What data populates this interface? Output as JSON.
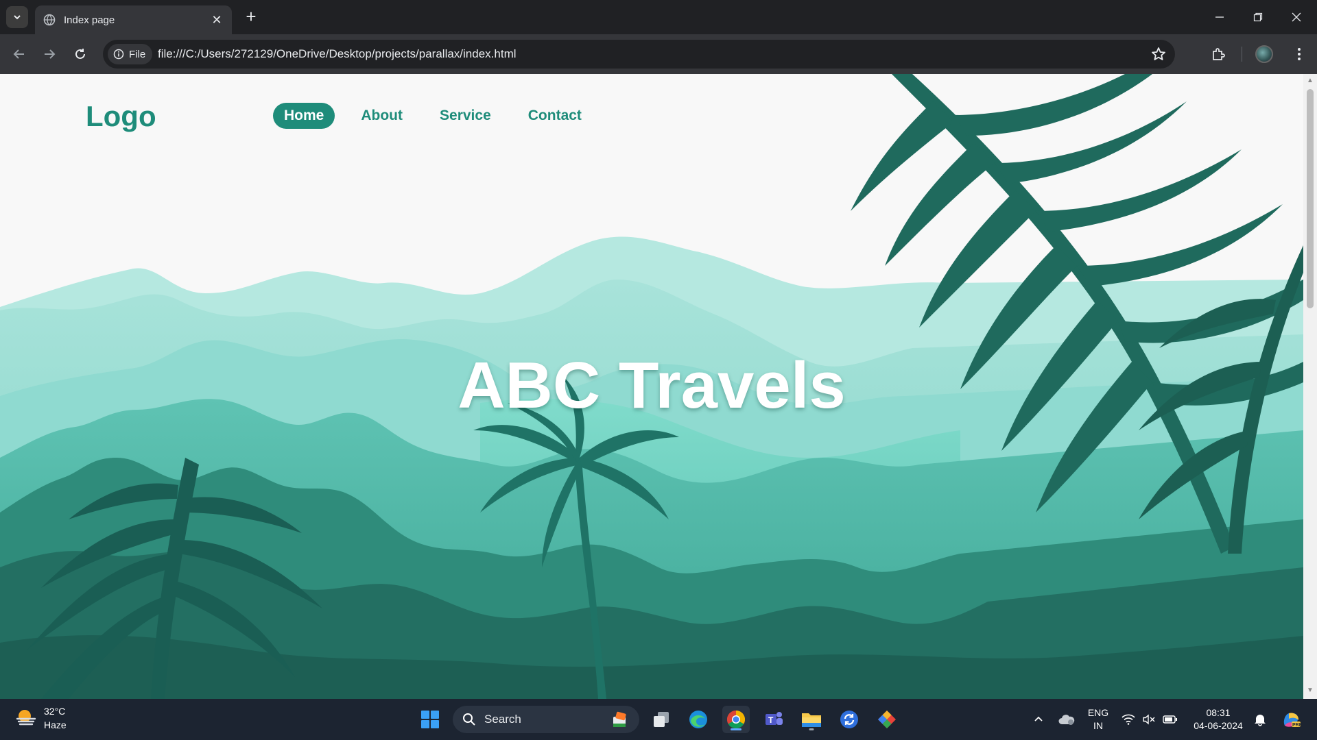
{
  "browser": {
    "tab_title": "Index page",
    "site_chip_label": "File",
    "url": "file:///C:/Users/272129/OneDrive/Desktop/projects/parallax/index.html"
  },
  "page": {
    "logo": "Logo",
    "nav": [
      {
        "label": "Home",
        "active": true
      },
      {
        "label": "About",
        "active": false
      },
      {
        "label": "Service",
        "active": false
      },
      {
        "label": "Contact",
        "active": false
      }
    ],
    "hero_title": "ABC Travels",
    "colors": {
      "accent": "#1e8c7a",
      "background": "#f8f8f8"
    }
  },
  "taskbar": {
    "weather_temp": "32°C",
    "weather_desc": "Haze",
    "search_label": "Search",
    "lang_top": "ENG",
    "lang_bottom": "IN",
    "time": "08:31",
    "date": "04-06-2024",
    "pinned_apps": [
      "start-icon",
      "task-view-icon",
      "edge-icon",
      "chrome-icon",
      "teams-icon",
      "file-explorer-icon",
      "sync-icon",
      "git-icon"
    ]
  }
}
